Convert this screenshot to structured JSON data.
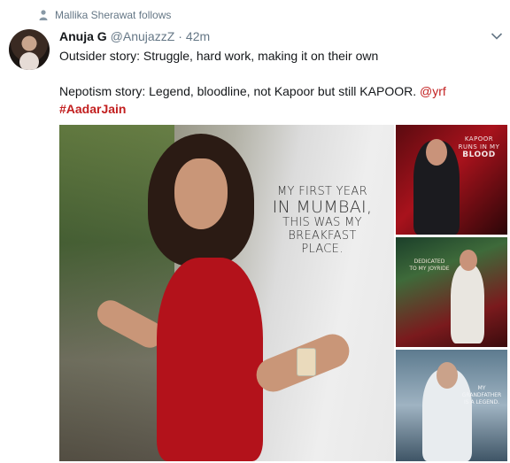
{
  "social_context": {
    "text": "Mallika Sherawat follows",
    "icon": "person-icon"
  },
  "tweet": {
    "name": "Anuja G",
    "handle": "@AnujazzZ",
    "separator": "·",
    "time": "42m",
    "line1": "Outsider story: Struggle, hard work, making it on their own",
    "line2": "Nepotism story: Legend, bloodline, not Kapoor but still KAPOOR.",
    "mention": "@yrf",
    "hashtag": "#AadarJain"
  },
  "media": {
    "main_overlay": [
      "MY FIRST YEAR",
      "IN MUMBAI,",
      "THIS WAS MY",
      "BREAKFAST PLACE."
    ],
    "side1_overlay": [
      "KAPOOR",
      "RUNS IN MY",
      "BLOOD"
    ],
    "side2_overlay": [
      "DEDICATED",
      "TO MY JOYRIDE"
    ],
    "side3_overlay": [
      "MY GRANDFATHER",
      "IS A LEGEND."
    ]
  },
  "colors": {
    "link": "#c21f1f",
    "secondary_text": "#657786",
    "text": "#14171a"
  }
}
